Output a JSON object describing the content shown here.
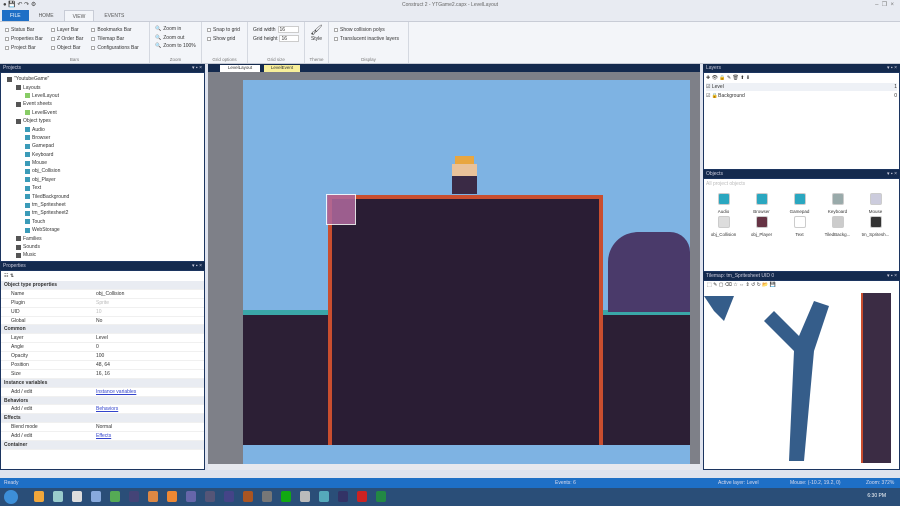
{
  "window": {
    "title": "Construct 2 - YTGame2.capx - LevelLayout"
  },
  "tabs": [
    "FILE",
    "HOME",
    "VIEW",
    "EVENTS"
  ],
  "ribbon": {
    "bars": {
      "label": "Bars",
      "items": [
        "Status Bar",
        "Properties Bar",
        "Project Bar",
        "Layer Bar",
        "Z Order Bar",
        "Object Bar",
        "Bookmarks Bar",
        "Tilemap Bar",
        "Configurations Bar"
      ]
    },
    "zoom": {
      "label": "Zoom",
      "items": [
        "Zoom in",
        "Zoom out",
        "Zoom to 100%"
      ]
    },
    "grid_options": {
      "label": "Grid options",
      "items": [
        "Snap to grid",
        "Show grid"
      ]
    },
    "grid_size": {
      "label": "Grid size",
      "width_label": "Grid width",
      "width": "16",
      "height_label": "Grid height",
      "height": "16"
    },
    "theme": {
      "label": "Theme",
      "style": "Style"
    },
    "display": {
      "label": "Display",
      "items": [
        "Show collision polys",
        "Translucent inactive layers"
      ]
    }
  },
  "projects": {
    "title": "Projects",
    "items": [
      {
        "label": "\"YoutubeGame\"",
        "level": 0
      },
      {
        "label": "Layouts",
        "level": 1
      },
      {
        "label": "LevelLayout",
        "level": 2
      },
      {
        "label": "Event sheets",
        "level": 1
      },
      {
        "label": "LevelEvent",
        "level": 2
      },
      {
        "label": "Object types",
        "level": 1
      },
      {
        "label": "Audio",
        "level": 2
      },
      {
        "label": "Browser",
        "level": 2
      },
      {
        "label": "Gamepad",
        "level": 2
      },
      {
        "label": "Keyboard",
        "level": 2
      },
      {
        "label": "Mouse",
        "level": 2
      },
      {
        "label": "obj_Collision",
        "level": 2
      },
      {
        "label": "obj_Player",
        "level": 2
      },
      {
        "label": "Text",
        "level": 2
      },
      {
        "label": "TiledBackground",
        "level": 2
      },
      {
        "label": "tm_Spritesheet",
        "level": 2
      },
      {
        "label": "tm_Spritesheet2",
        "level": 2
      },
      {
        "label": "Touch",
        "level": 2
      },
      {
        "label": "WebStorage",
        "level": 2
      },
      {
        "label": "Families",
        "level": 1
      },
      {
        "label": "Sounds",
        "level": 1
      },
      {
        "label": "Music",
        "level": 1
      }
    ]
  },
  "properties": {
    "title": "Properties",
    "rows": [
      {
        "k": "Object type properties",
        "sec": true
      },
      {
        "k": "Name",
        "v": "obj_Collision"
      },
      {
        "k": "Plugin",
        "v": "Sprite",
        "dim": true
      },
      {
        "k": "UID",
        "v": "10",
        "dim": true
      },
      {
        "k": "Global",
        "v": "No"
      },
      {
        "k": "Common",
        "sec": true
      },
      {
        "k": "Layer",
        "v": "Level"
      },
      {
        "k": "Angle",
        "v": "0"
      },
      {
        "k": "Opacity",
        "v": "100"
      },
      {
        "k": "Position",
        "v": "48, 64"
      },
      {
        "k": "Size",
        "v": "16, 16"
      },
      {
        "k": "Instance variables",
        "sec": true
      },
      {
        "k": "Add / edit",
        "v": "Instance variables",
        "link": true
      },
      {
        "k": "Behaviors",
        "sec": true
      },
      {
        "k": "Add / edit",
        "v": "Behaviors",
        "link": true
      },
      {
        "k": "Effects",
        "sec": true
      },
      {
        "k": "Blend mode",
        "v": "Normal"
      },
      {
        "k": "Add / edit",
        "v": "Effects",
        "link": true
      },
      {
        "k": "Container",
        "sec": true
      }
    ]
  },
  "editor_tabs": [
    "LevelLayout",
    "LevelEvent"
  ],
  "layers": {
    "title": "Layers",
    "items": [
      {
        "name": "Level",
        "index": "1"
      },
      {
        "name": "Background",
        "index": "0"
      }
    ]
  },
  "objects": {
    "title": "Objects",
    "search": "All project objects",
    "items": [
      "Audio",
      "Browser",
      "Gamepad",
      "Keyboard",
      "Mouse",
      "obj_Collision",
      "obj_Player",
      "Text",
      "TiledBackg...",
      "tm_Spritesh..."
    ]
  },
  "tilemap": {
    "title": "Tilemap: tm_Spritesheet UID 0"
  },
  "status": {
    "ready": "Ready",
    "events": "Events: 6",
    "layer": "Active layer: Level",
    "mouse": "Mouse: (-10.2, 19.2, 0)",
    "zoom": "Zoom: 372%"
  },
  "taskbar": {
    "time": "6:30 PM"
  },
  "colors": {
    "accent": "#1e6fc6",
    "dock": "#142a4e",
    "sky": "#7eb3e3",
    "ground": "#2c1f35",
    "brick": "#d0522e"
  }
}
